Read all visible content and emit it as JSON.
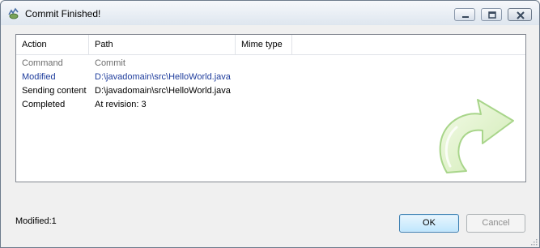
{
  "window": {
    "title": "Commit Finished!",
    "app_icon": "tortoise-svn-icon",
    "caption_buttons": [
      "minimize-icon",
      "maximize-icon",
      "close-icon"
    ]
  },
  "list": {
    "columns": [
      "Action",
      "Path",
      "Mime type"
    ],
    "rows": [
      {
        "action": "Command",
        "path": "Commit",
        "mime": "",
        "color": "#6d6d6d"
      },
      {
        "action": "Modified",
        "path": "D:\\javadomain\\src\\HelloWorld.java",
        "mime": "",
        "color": "#1e3c9c"
      },
      {
        "action": "Sending content",
        "path": "D:\\javadomain\\src\\HelloWorld.java",
        "mime": "",
        "color": "#000000"
      },
      {
        "action": "Completed",
        "path": "At revision: 3",
        "mime": "",
        "color": "#000000"
      }
    ],
    "watermark_icon": "commit-arrow-icon"
  },
  "footer": {
    "status": "Modified:1",
    "ok_label": "OK",
    "cancel_label": "Cancel"
  },
  "colors": {
    "accent": "#3c7fb1",
    "modified_text": "#1e3c9c",
    "command_text": "#6d6d6d",
    "disabled_text": "#8d8d8d"
  }
}
